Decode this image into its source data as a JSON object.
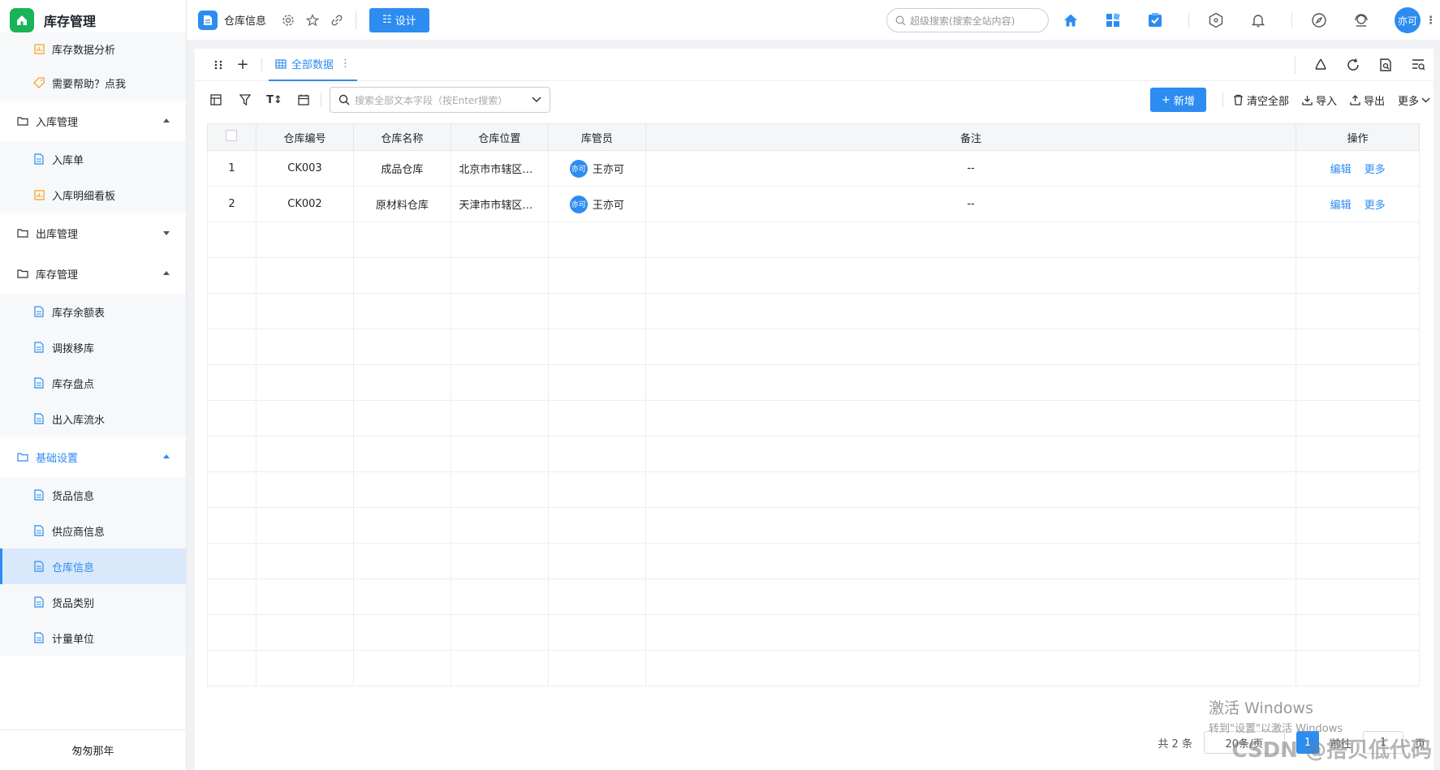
{
  "app": {
    "title": "库存管理"
  },
  "sidebar": {
    "items": [
      {
        "label": "库存数据分析",
        "icon": "chart-icon"
      },
      {
        "label": "需要帮助？点我",
        "icon": "tag-icon"
      },
      {
        "label": "入库管理",
        "group": true,
        "expanded": true
      },
      {
        "label": "入库单",
        "icon": "doc-icon"
      },
      {
        "label": "入库明细看板",
        "icon": "chart-icon"
      },
      {
        "label": "出库管理",
        "group": true,
        "expanded": false
      },
      {
        "label": "库存管理",
        "group": true,
        "expanded": true
      },
      {
        "label": "库存余额表",
        "icon": "doc-icon"
      },
      {
        "label": "调拨移库",
        "icon": "doc-icon"
      },
      {
        "label": "库存盘点",
        "icon": "doc-icon"
      },
      {
        "label": "出入库流水",
        "icon": "doc-icon"
      },
      {
        "label": "基础设置",
        "group": true,
        "expanded": true
      },
      {
        "label": "货品信息",
        "icon": "doc-icon"
      },
      {
        "label": "供应商信息",
        "icon": "doc-icon"
      },
      {
        "label": "仓库信息",
        "icon": "doc-icon",
        "active": true
      },
      {
        "label": "货品类别",
        "icon": "doc-icon"
      },
      {
        "label": "计量单位",
        "icon": "doc-icon"
      }
    ],
    "footer": "匆匆那年"
  },
  "topbar": {
    "page_name": "仓库信息",
    "design_label": "设计",
    "search_placeholder": "超级搜索(搜索全站内容)",
    "avatar_text": "亦可"
  },
  "view": {
    "tab_label": "全部数据"
  },
  "toolbar": {
    "search_placeholder": "搜索全部文本字段（按Enter搜索）",
    "add_label": "新增",
    "clear_label": "清空全部",
    "import_label": "导入",
    "export_label": "导出",
    "more_label": "更多"
  },
  "table": {
    "columns": [
      "",
      "仓库编号",
      "仓库名称",
      "仓库位置",
      "库管员",
      "备注",
      "操作"
    ],
    "rows": [
      {
        "index": "1",
        "code": "CK003",
        "name": "成品仓库",
        "location": "北京市市辖区东城区",
        "keeper": "王亦可",
        "keeper_avatar": "亦可",
        "note": "--",
        "edit": "编辑",
        "more": "更多"
      },
      {
        "index": "2",
        "code": "CK002",
        "name": "原材料仓库",
        "location": "天津市市辖区和平区",
        "keeper": "王亦可",
        "keeper_avatar": "亦可",
        "note": "--",
        "edit": "编辑",
        "more": "更多"
      }
    ],
    "empty_rows": 13
  },
  "pager": {
    "total": "共 2 条",
    "page_size": "20条/页",
    "current": "1",
    "goto_label": "前往",
    "goto_value": "1",
    "page_unit": "页"
  },
  "overlay": {
    "activate_title": "激活 Windows",
    "activate_sub": "转到\"设置\"以激活 Windows",
    "csdn_mark": "CSDN @搭贝低代码"
  },
  "colors": {
    "accent": "#2d8cf0",
    "brand": "#19b35a"
  }
}
